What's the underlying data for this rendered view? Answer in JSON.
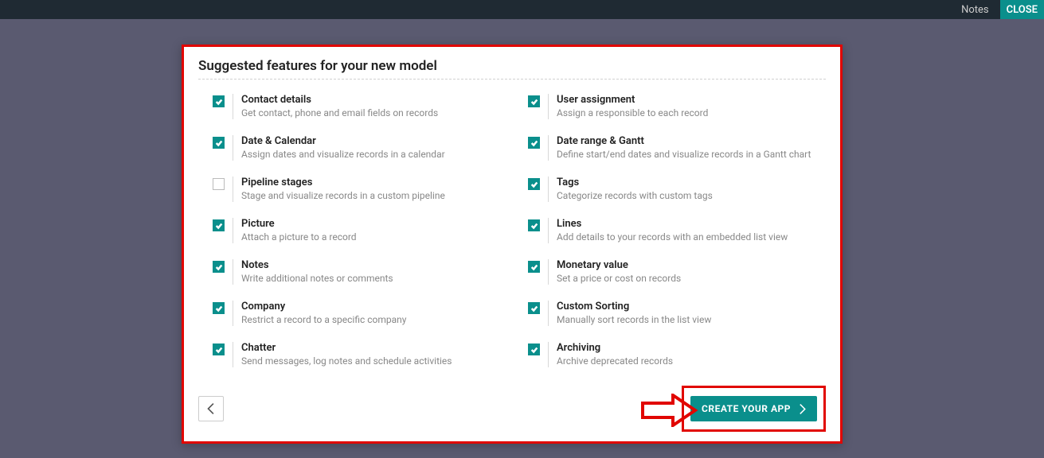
{
  "topbar": {
    "notes": "Notes",
    "close": "CLOSE"
  },
  "dialog": {
    "title": "Suggested features for your new model",
    "create_label": "CREATE YOUR APP"
  },
  "features_left": [
    {
      "title": "Contact details",
      "desc": "Get contact, phone and email fields on records",
      "checked": true
    },
    {
      "title": "Date & Calendar",
      "desc": "Assign dates and visualize records in a calendar",
      "checked": true
    },
    {
      "title": "Pipeline stages",
      "desc": "Stage and visualize records in a custom pipeline",
      "checked": false
    },
    {
      "title": "Picture",
      "desc": "Attach a picture to a record",
      "checked": true
    },
    {
      "title": "Notes",
      "desc": "Write additional notes or comments",
      "checked": true
    },
    {
      "title": "Company",
      "desc": "Restrict a record to a specific company",
      "checked": true
    },
    {
      "title": "Chatter",
      "desc": "Send messages, log notes and schedule activities",
      "checked": true
    }
  ],
  "features_right": [
    {
      "title": "User assignment",
      "desc": "Assign a responsible to each record",
      "checked": true
    },
    {
      "title": "Date range & Gantt",
      "desc": "Define start/end dates and visualize records in a Gantt chart",
      "checked": true
    },
    {
      "title": "Tags",
      "desc": "Categorize records with custom tags",
      "checked": true
    },
    {
      "title": "Lines",
      "desc": "Add details to your records with an embedded list view",
      "checked": true
    },
    {
      "title": "Monetary value",
      "desc": "Set a price or cost on records",
      "checked": true
    },
    {
      "title": "Custom Sorting",
      "desc": "Manually sort records in the list view",
      "checked": true
    },
    {
      "title": "Archiving",
      "desc": "Archive deprecated records",
      "checked": true
    }
  ]
}
